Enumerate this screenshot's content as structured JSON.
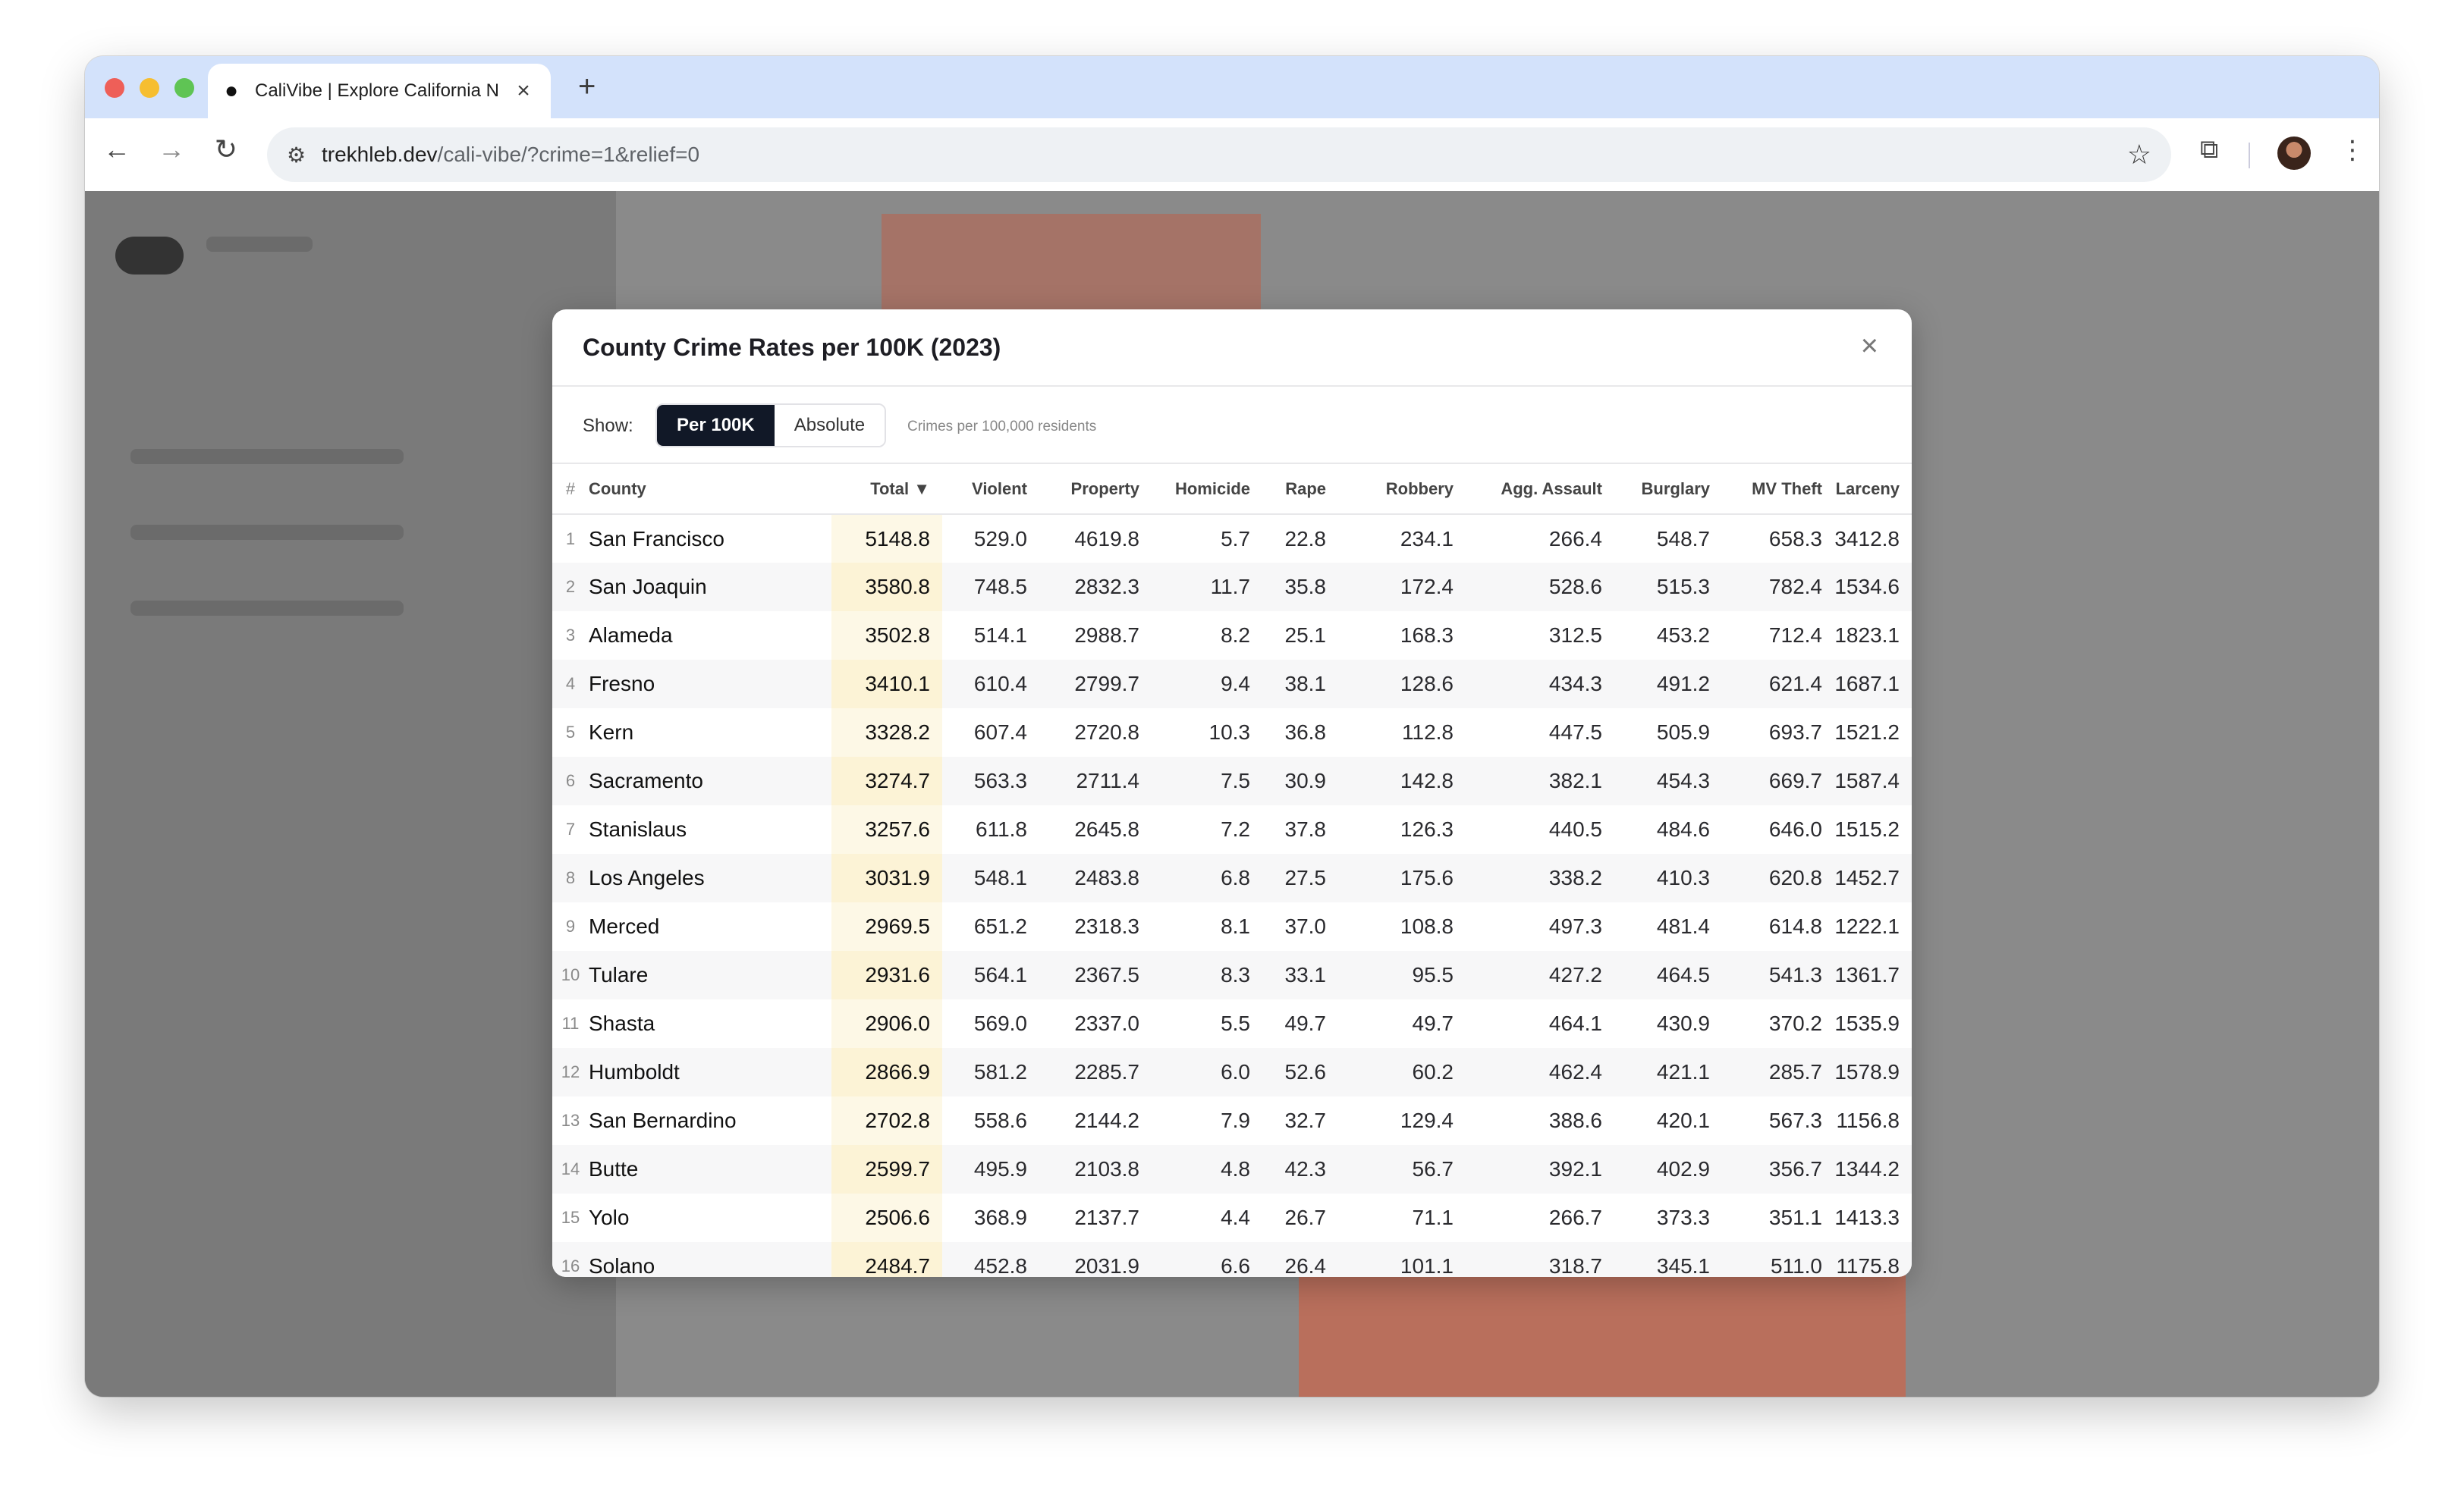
{
  "browser": {
    "tab_title": "CaliVibe | Explore California N",
    "tab_close": "×",
    "new_tab": "+",
    "url_host": "trekhleb.dev",
    "url_path": "/cali-vibe/?crime=1&relief=0"
  },
  "modal": {
    "title": "County Crime Rates per 100K (2023)",
    "close": "×",
    "show_label": "Show:",
    "toggle": [
      "Per 100K",
      "Absolute"
    ],
    "hint": "Crimes per 100,000 residents"
  },
  "table": {
    "headers": [
      "#",
      "County",
      "Total ▼",
      "Violent",
      "Property",
      "Homicide",
      "Rape",
      "Robbery",
      "Agg. Assault",
      "Burglary",
      "MV Theft",
      "Larceny"
    ],
    "rows": [
      [
        "1",
        "San Francisco",
        "5148.8",
        "529.0",
        "4619.8",
        "5.7",
        "22.8",
        "234.1",
        "266.4",
        "548.7",
        "658.3",
        "3412.8"
      ],
      [
        "2",
        "San Joaquin",
        "3580.8",
        "748.5",
        "2832.3",
        "11.7",
        "35.8",
        "172.4",
        "528.6",
        "515.3",
        "782.4",
        "1534.6"
      ],
      [
        "3",
        "Alameda",
        "3502.8",
        "514.1",
        "2988.7",
        "8.2",
        "25.1",
        "168.3",
        "312.5",
        "453.2",
        "712.4",
        "1823.1"
      ],
      [
        "4",
        "Fresno",
        "3410.1",
        "610.4",
        "2799.7",
        "9.4",
        "38.1",
        "128.6",
        "434.3",
        "491.2",
        "621.4",
        "1687.1"
      ],
      [
        "5",
        "Kern",
        "3328.2",
        "607.4",
        "2720.8",
        "10.3",
        "36.8",
        "112.8",
        "447.5",
        "505.9",
        "693.7",
        "1521.2"
      ],
      [
        "6",
        "Sacramento",
        "3274.7",
        "563.3",
        "2711.4",
        "7.5",
        "30.9",
        "142.8",
        "382.1",
        "454.3",
        "669.7",
        "1587.4"
      ],
      [
        "7",
        "Stanislaus",
        "3257.6",
        "611.8",
        "2645.8",
        "7.2",
        "37.8",
        "126.3",
        "440.5",
        "484.6",
        "646.0",
        "1515.2"
      ],
      [
        "8",
        "Los Angeles",
        "3031.9",
        "548.1",
        "2483.8",
        "6.8",
        "27.5",
        "175.6",
        "338.2",
        "410.3",
        "620.8",
        "1452.7"
      ],
      [
        "9",
        "Merced",
        "2969.5",
        "651.2",
        "2318.3",
        "8.1",
        "37.0",
        "108.8",
        "497.3",
        "481.4",
        "614.8",
        "1222.1"
      ],
      [
        "10",
        "Tulare",
        "2931.6",
        "564.1",
        "2367.5",
        "8.3",
        "33.1",
        "95.5",
        "427.2",
        "464.5",
        "541.3",
        "1361.7"
      ],
      [
        "11",
        "Shasta",
        "2906.0",
        "569.0",
        "2337.0",
        "5.5",
        "49.7",
        "49.7",
        "464.1",
        "430.9",
        "370.2",
        "1535.9"
      ],
      [
        "12",
        "Humboldt",
        "2866.9",
        "581.2",
        "2285.7",
        "6.0",
        "52.6",
        "60.2",
        "462.4",
        "421.1",
        "285.7",
        "1578.9"
      ],
      [
        "13",
        "San Bernardino",
        "2702.8",
        "558.6",
        "2144.2",
        "7.9",
        "32.7",
        "129.4",
        "388.6",
        "420.1",
        "567.3",
        "1156.8"
      ],
      [
        "14",
        "Butte",
        "2599.7",
        "495.9",
        "2103.8",
        "4.8",
        "42.3",
        "56.7",
        "392.1",
        "402.9",
        "356.7",
        "1344.2"
      ],
      [
        "15",
        "Yolo",
        "2506.6",
        "368.9",
        "2137.7",
        "4.4",
        "26.7",
        "71.1",
        "266.7",
        "373.3",
        "351.1",
        "1413.3"
      ],
      [
        "16",
        "Solano",
        "2484.7",
        "452.8",
        "2031.9",
        "6.6",
        "26.4",
        "101.1",
        "318.7",
        "345.1",
        "511.0",
        "1175.8"
      ]
    ]
  }
}
